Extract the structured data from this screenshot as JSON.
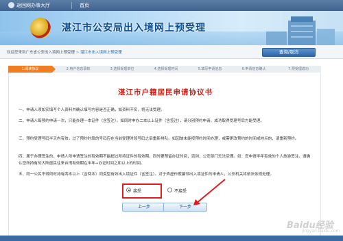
{
  "topbar": {
    "back_label": "返回网办事大厅",
    "home_label": "首页"
  },
  "banner": {
    "title": "湛江市公安局出入境网上预受理"
  },
  "breadcrumb": {
    "lead": "欢迎您来到广东省公安出入境网上预受理",
    "mid": "湛江市出入境网上预受理",
    "separator": ">"
  },
  "query_button": "查询/取消",
  "steps": [
    {
      "label": "1.阅读协议",
      "active": true
    },
    {
      "label": "2.用户信息录核",
      "active": false
    },
    {
      "label": "3.选择受理单位",
      "active": false
    },
    {
      "label": "4.选择受理时间",
      "active": false
    },
    {
      "label": "5.填写申请信息",
      "active": false
    },
    {
      "label": "6.申请信息确认",
      "active": false
    },
    {
      "label": "7.预受理成功",
      "active": false
    }
  ],
  "agreement": {
    "title": "湛江市户籍居民申请协议书",
    "paragraphs": [
      "一、申请人须如实填写个人资料并确认填写内容是否正确，如资料不实，将无法受理。",
      "二、申请人每预约申请一次，只能办理一本证件（含签注）。如同时申办二本以上证件（含签注），请分别预约申请，成功取得受理号后方能受理。",
      "三、预约受理号码半天内有效，过了预约时段的号码应在当前受理时段号码之后重新排队。如因故未能按预约时间办理，或需更改预约的时间或地点的，请重新预约。",
      "四、属于办理签注的，申请人所申请签注的有效期不能超过所持证件的有效期，同时要预留办证时间，否则，公安部门无法受理。如：您申请半年有效的个人旅游签注，请确认您所持有的大陆居民往来台湾有效期在半年+办证时间之和以上的时间。",
      "五、同一公民不得同时持有两本以上（含两本）同类型有效出入境证件（含签注）。对于弄虚作假骗领出入境证件的申请人，公安机关将依法依规处理。"
    ]
  },
  "consent": {
    "accept_label": "接受",
    "reject_label": "不接受",
    "selected": "accept"
  },
  "buttons": {
    "prev_label": "上一步",
    "next_label": "下一步"
  },
  "watermark": {
    "text": "Baidu经验",
    "sub": "jingyan.baidu.com"
  },
  "colors": {
    "accent_orange": "#f07d1f",
    "title_red": "#d0241b",
    "nav_blue": "#3f6390",
    "highlight_red": "#e11b1b"
  }
}
